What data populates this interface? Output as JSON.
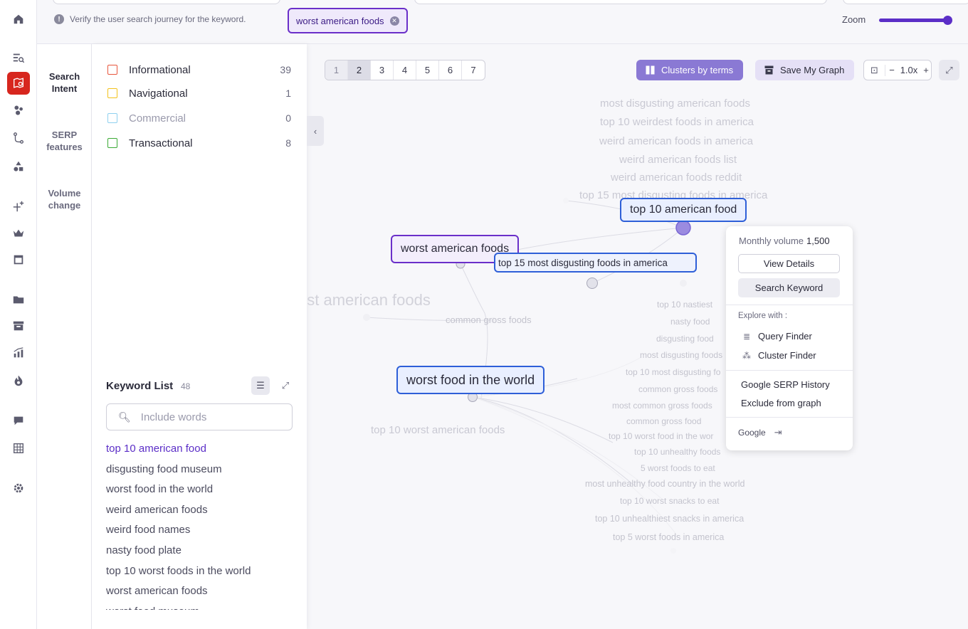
{
  "topbar": {
    "verify_text": "Verify the user search journey for the keyword.",
    "chip_label": "worst american foods",
    "zoom_label": "Zoom"
  },
  "tabs": {
    "search_intent": "Search Intent",
    "serp_features": "SERP features",
    "volume_change": "Volume change"
  },
  "intents": [
    {
      "label": "Informational",
      "count": "39",
      "color": "#e8553c"
    },
    {
      "label": "Navigational",
      "count": "1",
      "color": "#f2c21b"
    },
    {
      "label": "Commercial",
      "count": "0",
      "color": "#8fd0ef"
    },
    {
      "label": "Transactional",
      "count": "8",
      "color": "#3aaa35"
    }
  ],
  "keyword_list": {
    "title": "Keyword List",
    "count": "48",
    "search_placeholder": "Include words",
    "items": [
      "top 10 american food",
      "disgusting food museum",
      "worst food in the world",
      "weird american foods",
      "weird food names",
      "nasty food plate",
      "top 10 worst foods in the world",
      "worst american foods",
      "worst food museum"
    ]
  },
  "pager": {
    "pages": [
      "1",
      "2",
      "3",
      "4",
      "5",
      "6",
      "7"
    ],
    "active": "2"
  },
  "toolbar": {
    "clusters_label": "Clusters by terms",
    "save_label": "Save My Graph",
    "zoom_level": "1.0x"
  },
  "graph": {
    "nodes": {
      "top_american": "top 10 american food",
      "worst_american": "worst american foods",
      "top15_disgusting": "top 15 most disgusting foods in america",
      "worst_world": "worst food in the world"
    },
    "ghost_labels_top": [
      "most disgusting american foods",
      "top 10 weirdest foods in america",
      "weird american foods in america",
      "weird american foods list",
      "weird american foods reddit",
      "top 15 most disgusting foods in america"
    ],
    "ghost_large": "ost american foods",
    "ghost_common": "common gross foods",
    "ghost_top10_worst": "top 10 worst american foods",
    "ghost_labels_right": [
      "top 10 nastiest",
      "nasty food",
      "disgusting food",
      "most disgusting foods",
      "top 10 most disgusting fo",
      "common gross foods",
      "most common gross foods",
      "common gross food",
      "top 10 worst food in the wor",
      "top 10 unhealthy foods",
      "5 worst foods to eat",
      "most unhealthy food country in the world",
      "top 10 worst snacks to eat",
      "top 10 unhealthiest snacks in america",
      "top 5 worst foods in america"
    ]
  },
  "popup": {
    "monthly_volume_label": "Monthly volume",
    "monthly_volume_value": "1,500",
    "view_details": "View Details",
    "search_keyword": "Search Keyword",
    "explore_with": "Explore with :",
    "query_finder": "Query Finder",
    "cluster_finder": "Cluster Finder",
    "serp_history": "Google SERP History",
    "exclude": "Exclude from graph",
    "google": "Google"
  },
  "colors": {
    "accent": "#5b2ec7",
    "node_border": "#2e5fd8",
    "active_rail": "#d7261e"
  }
}
